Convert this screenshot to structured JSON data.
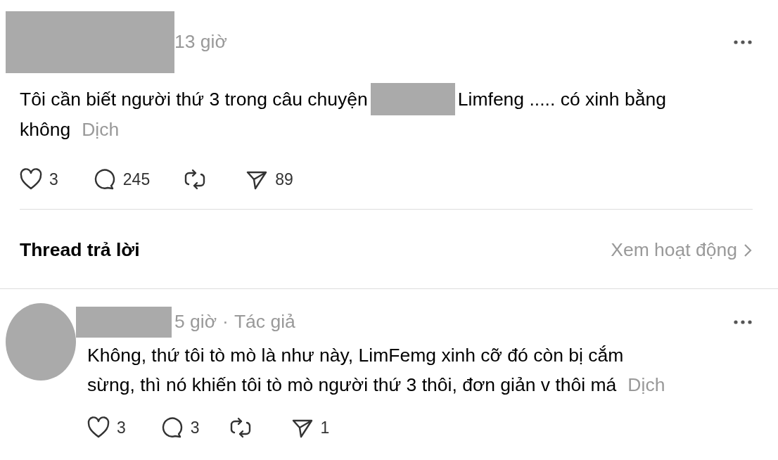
{
  "post": {
    "time": "13 giờ",
    "body_before": "Tôi cần biết người thứ 3 trong câu chuyện",
    "body_after": "Limfeng ..... có xinh bằng",
    "body_line2": "không",
    "translate": "Dịch",
    "actions": [
      {
        "kind": "like",
        "count": "3"
      },
      {
        "kind": "reply",
        "count": "245"
      },
      {
        "kind": "repost"
      },
      {
        "kind": "share",
        "count": "89"
      }
    ]
  },
  "replies_header": {
    "title": "Thread trả lời",
    "link": "Xem hoạt động"
  },
  "reply": {
    "time": "5 giờ",
    "separator": "·",
    "role": "Tác giả",
    "body_lines": [
      "Không, thứ tôi tò mò là như này, LimFemg xinh cỡ đó còn bị cắm",
      "sừng, thì nó khiến tôi tò mò người thứ 3 thôi, đơn giản v thôi má"
    ],
    "translate": "Dịch",
    "actions": [
      {
        "kind": "like",
        "count": "3"
      },
      {
        "kind": "reply",
        "count": "3"
      },
      {
        "kind": "repost"
      },
      {
        "kind": "share",
        "count": "1"
      }
    ]
  }
}
